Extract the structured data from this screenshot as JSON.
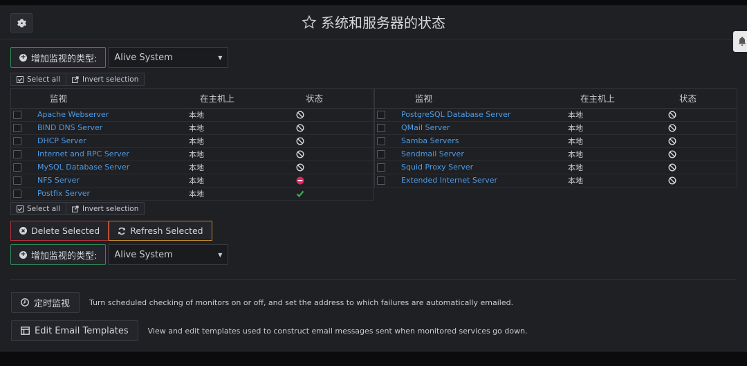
{
  "header": {
    "title": "系统和服务器的状态"
  },
  "add_monitor": {
    "button_label": "增加监视的类型:",
    "select_value": "Alive System"
  },
  "selection": {
    "select_all": "Select all",
    "invert": "Invert selection"
  },
  "table_headers": {
    "monitor": "监视",
    "host": "在主机上",
    "status": "状态"
  },
  "left_rows": [
    {
      "name": "Apache Webserver",
      "host": "本地",
      "status": "disabled"
    },
    {
      "name": "BIND DNS Server",
      "host": "本地",
      "status": "disabled"
    },
    {
      "name": "DHCP Server",
      "host": "本地",
      "status": "disabled"
    },
    {
      "name": "Internet and RPC Server",
      "host": "本地",
      "status": "disabled"
    },
    {
      "name": "MySQL Database Server",
      "host": "本地",
      "status": "disabled"
    },
    {
      "name": "NFS Server",
      "host": "本地",
      "status": "down"
    },
    {
      "name": "Postfix Server",
      "host": "本地",
      "status": "up"
    }
  ],
  "right_rows": [
    {
      "name": "PostgreSQL Database Server",
      "host": "本地",
      "status": "disabled"
    },
    {
      "name": "QMail Server",
      "host": "本地",
      "status": "disabled"
    },
    {
      "name": "Samba Servers",
      "host": "本地",
      "status": "disabled"
    },
    {
      "name": "Sendmail Server",
      "host": "本地",
      "status": "disabled"
    },
    {
      "name": "Squid Proxy Server",
      "host": "本地",
      "status": "disabled"
    },
    {
      "name": "Extended Internet Server",
      "host": "本地",
      "status": "disabled"
    }
  ],
  "actions": {
    "delete": "Delete Selected",
    "refresh": "Refresh Selected"
  },
  "scheduled": {
    "button": "定时监视",
    "description": "Turn scheduled checking of monitors on or off, and set the address to which failures are automatically emailed."
  },
  "email": {
    "button": "Edit Email Templates",
    "description": "View and edit templates used to construct email messages sent when monitored services go down."
  },
  "colors": {
    "link": "#4d9be6",
    "ok": "#3cb054",
    "down": "#e0245e",
    "add_border": "#2f8a5b",
    "delete_border": "#b1323a",
    "refresh_border": "#c08a2b"
  }
}
